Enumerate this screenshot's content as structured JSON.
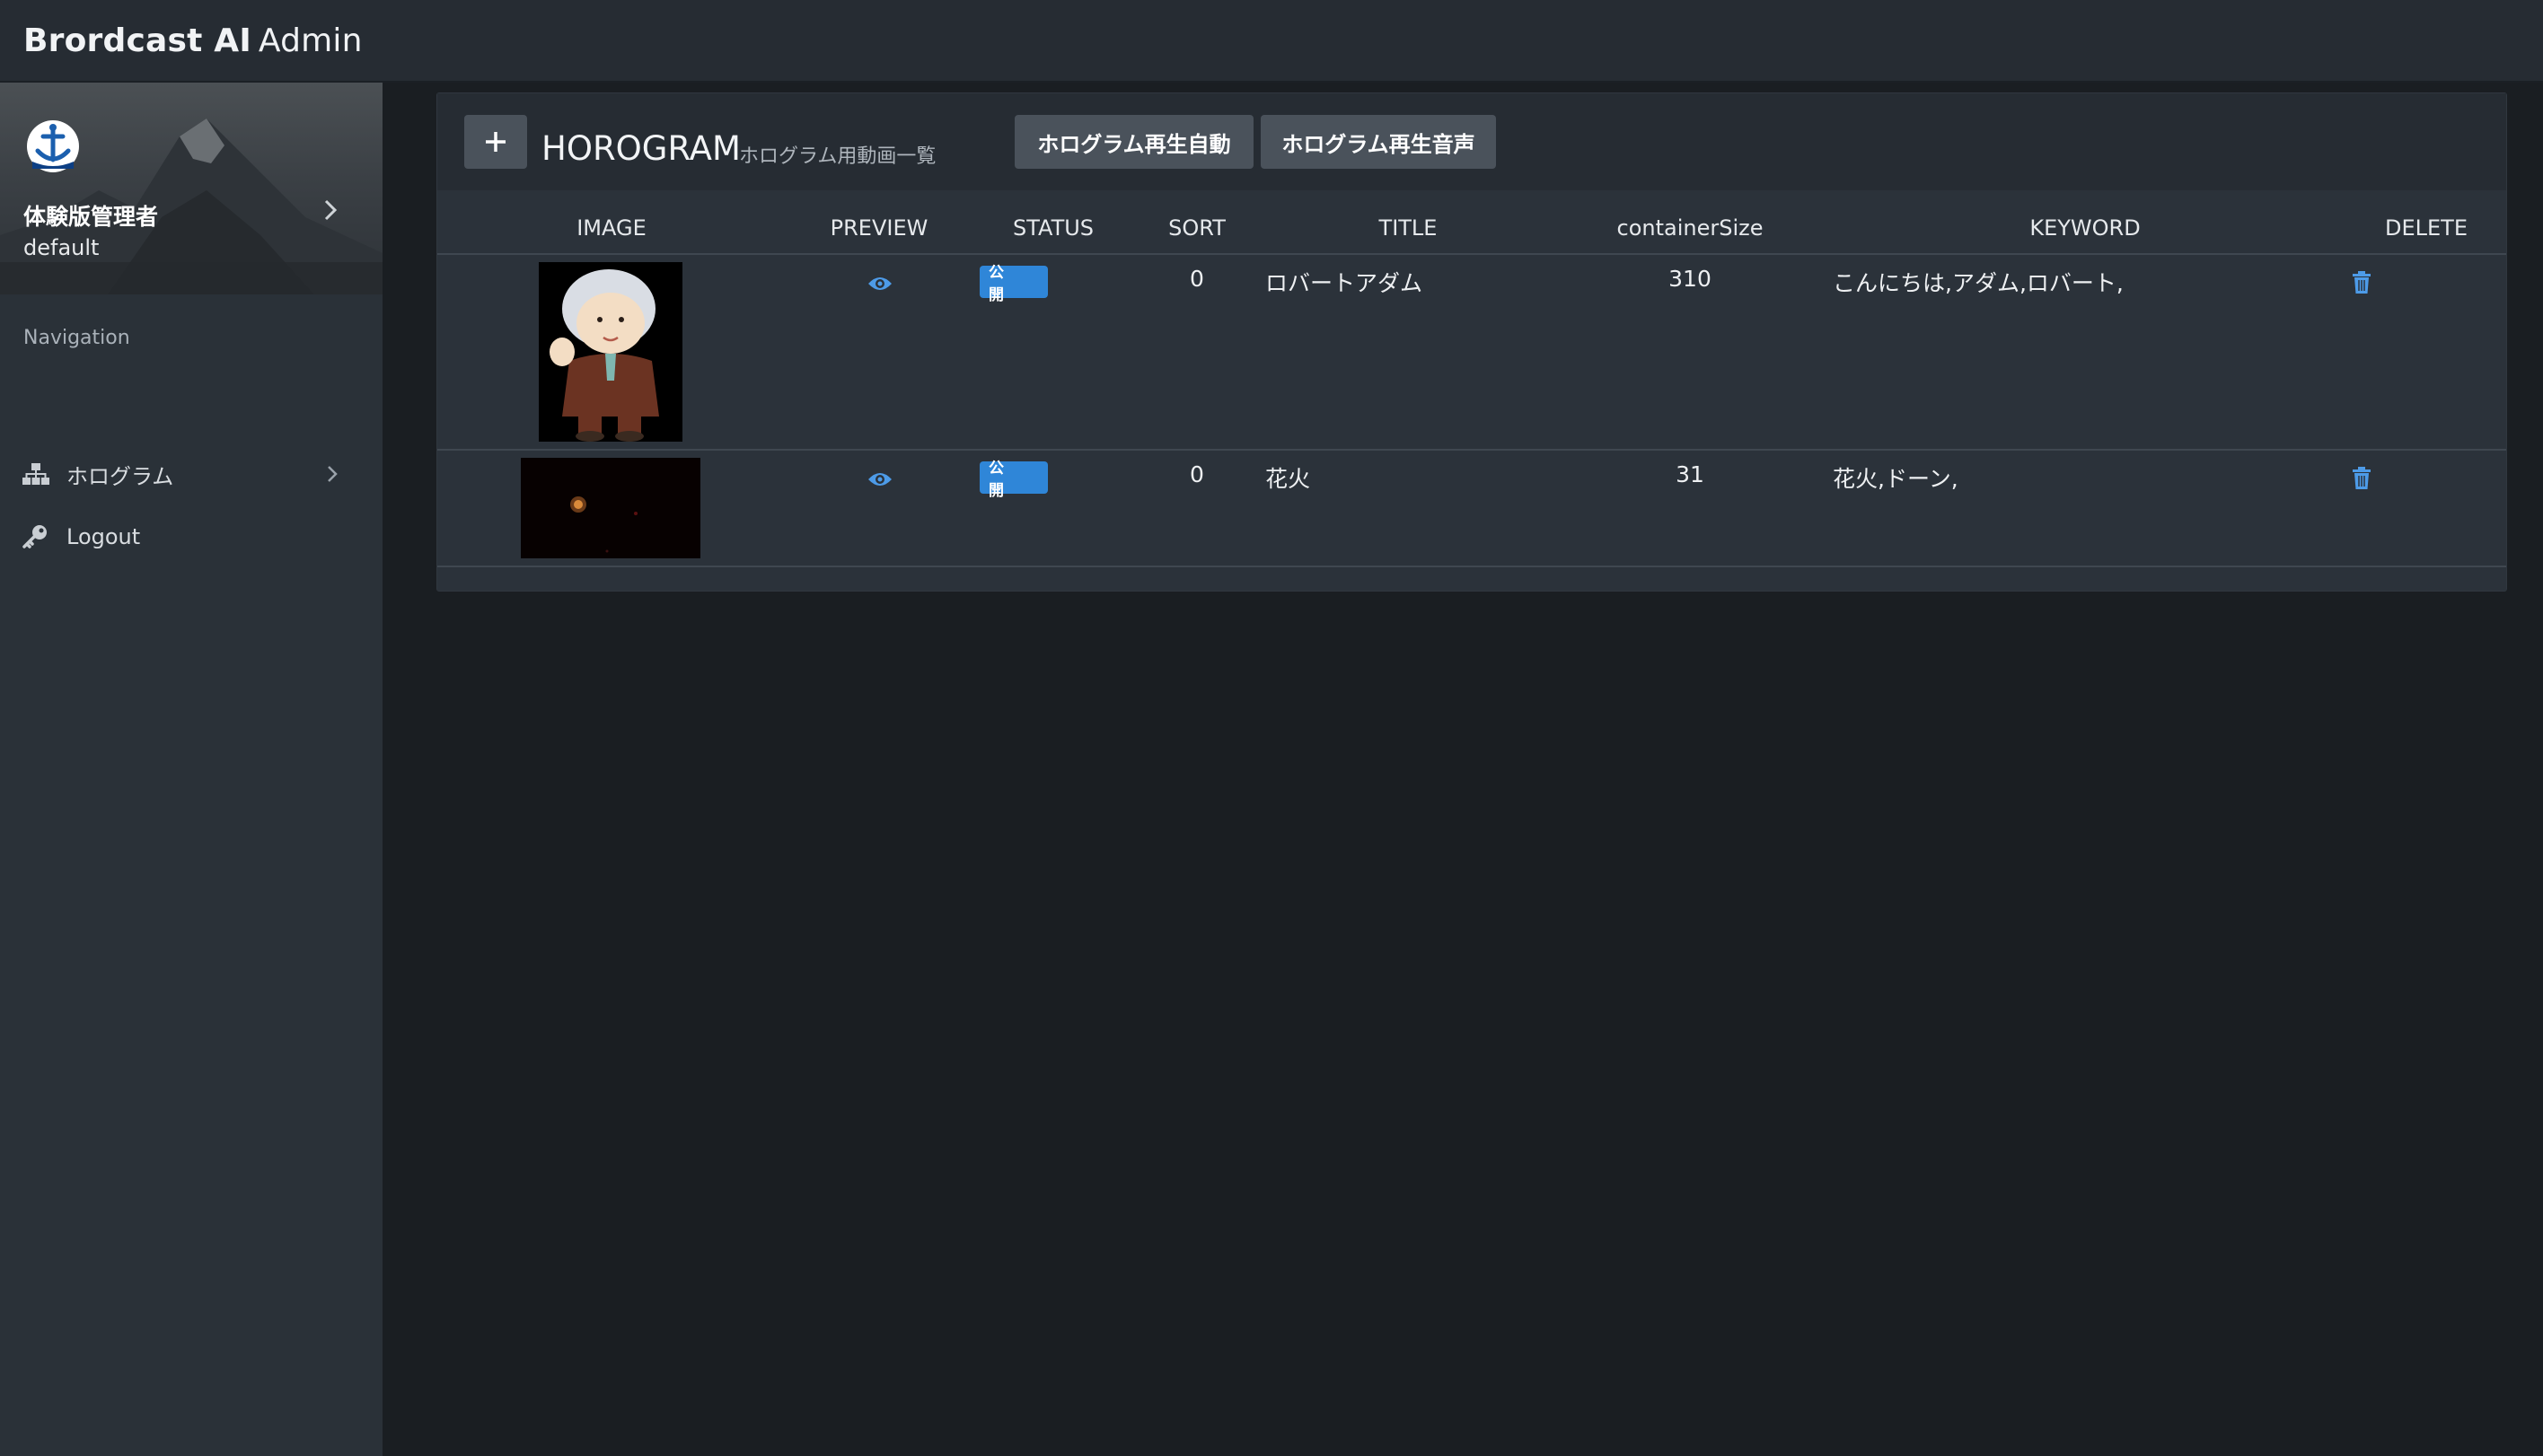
{
  "app": {
    "brand_bold": "Brordcast AI",
    "brand_light": "Admin"
  },
  "sidebar": {
    "profile": {
      "name": "体験版管理者",
      "role": "default"
    },
    "nav_heading": "Navigation",
    "items": [
      {
        "label": "ホログラム",
        "icon": "sitemap-icon"
      },
      {
        "label": "Logout",
        "icon": "key-icon"
      }
    ]
  },
  "panel": {
    "add_label": "+",
    "title": "HOROGRAM",
    "subtitle": "ホログラム用動画一覧",
    "buttons": {
      "auto": "ホログラム再生自動",
      "voice": "ホログラム再生音声"
    }
  },
  "table": {
    "columns": [
      "IMAGE",
      "PREVIEW",
      "STATUS",
      "SORT",
      "TITLE",
      "containerSize",
      "KEYWORD",
      "DELETE"
    ],
    "rows": [
      {
        "status": "公 開",
        "sort": "0",
        "title": "ロバートアダム",
        "containerSize": "310",
        "keyword": "こんにちは,アダム,ロバート,"
      },
      {
        "status": "公 開",
        "sort": "0",
        "title": "花火",
        "containerSize": "31",
        "keyword": "花火,ドーン,"
      }
    ]
  },
  "colors": {
    "accent": "#2f86d8",
    "icon_blue": "#4d9be8",
    "topbar": "#262c33",
    "sidebar": "#2a3138"
  }
}
